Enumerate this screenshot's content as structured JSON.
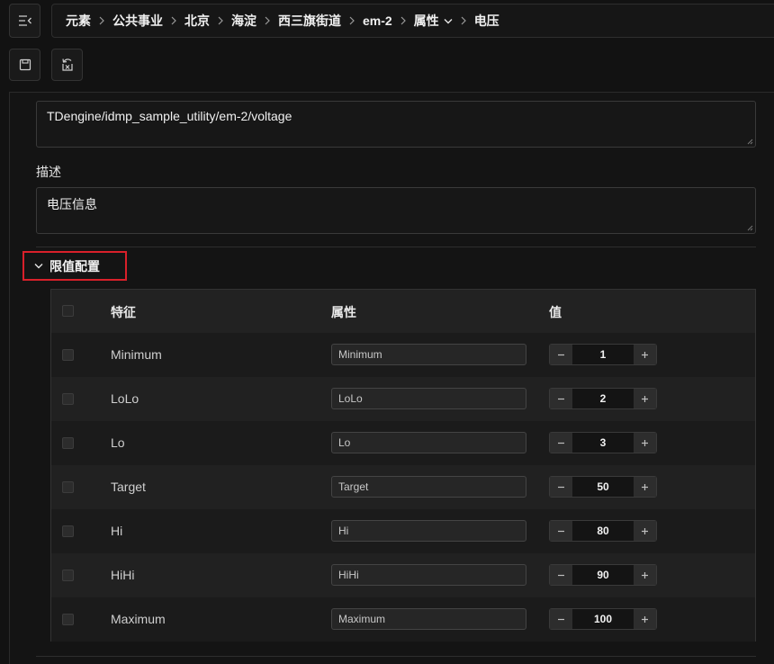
{
  "breadcrumb": [
    {
      "label": "元素"
    },
    {
      "label": "公共事业"
    },
    {
      "label": "北京"
    },
    {
      "label": "海淀"
    },
    {
      "label": "西三旗街道"
    },
    {
      "label": "em-2"
    },
    {
      "label": "属性",
      "dropdown": true
    },
    {
      "label": "电压"
    }
  ],
  "toolbar": {
    "save_icon": "save-icon",
    "discard_icon": "discard-changes-icon"
  },
  "form": {
    "path_value": "TDengine/idmp_sample_utility/em-2/voltage",
    "description_label": "描述",
    "description_value": "电压信息"
  },
  "limits_section": {
    "title": "限值配置",
    "columns": {
      "feature": "特征",
      "attribute": "属性",
      "value": "值"
    },
    "rows": [
      {
        "feature": "Minimum",
        "attribute": "Minimum",
        "value": "1"
      },
      {
        "feature": "LoLo",
        "attribute": "LoLo",
        "value": "2"
      },
      {
        "feature": "Lo",
        "attribute": "Lo",
        "value": "3"
      },
      {
        "feature": "Target",
        "attribute": "Target",
        "value": "50"
      },
      {
        "feature": "Hi",
        "attribute": "Hi",
        "value": "80"
      },
      {
        "feature": "HiHi",
        "attribute": "HiHi",
        "value": "90"
      },
      {
        "feature": "Maximum",
        "attribute": "Maximum",
        "value": "100"
      }
    ]
  },
  "colors": {
    "highlight_border": "#d9202a",
    "background": "#121212"
  }
}
